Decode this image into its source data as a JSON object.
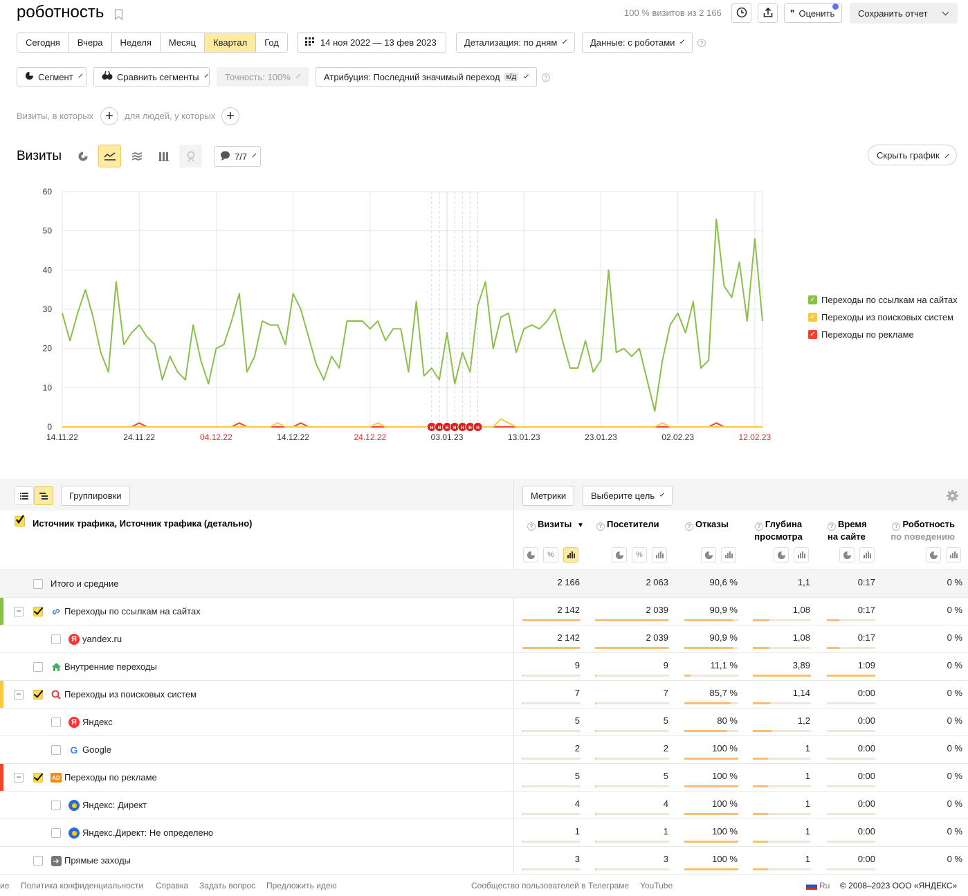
{
  "header": {
    "title": "роботность",
    "visits_info": "100 % визитов из 2 166",
    "rate_label": "Оценить",
    "save_label": "Сохранить отчет"
  },
  "periods": [
    "Сегодня",
    "Вчера",
    "Неделя",
    "Месяц",
    "Квартал",
    "Год"
  ],
  "active_period": "Квартал",
  "date_range": "14 ноя 2022 — 13 фев 2023",
  "detail_label": "Детализация: по дням",
  "data_label": "Данные: с роботами",
  "filters": {
    "segment": "Сегмент",
    "compare": "Сравнить сегменты",
    "accuracy": "Точность: 100%",
    "attribution": "Атрибуция: Последний значимый переход",
    "attribution_badge": "к/д"
  },
  "segment_builder": {
    "visits_label": "Визиты, в которых",
    "people_label": "для людей, у которых"
  },
  "chart_header": {
    "title": "Визиты",
    "annotations": "7/7",
    "hide_label": "Скрыть график"
  },
  "chart_data": {
    "type": "line",
    "x_tick_labels": [
      "14.11.22",
      "24.11.22",
      "04.12.22",
      "14.12.22",
      "24.12.22",
      "03.01.23",
      "13.01.23",
      "23.01.23",
      "02.02.23",
      "12.02.23"
    ],
    "x_tick_weekend": [
      false,
      false,
      true,
      false,
      true,
      false,
      false,
      false,
      false,
      true
    ],
    "y_ticks": [
      0,
      10,
      20,
      30,
      40,
      50,
      60
    ],
    "ylim": [
      0,
      60
    ],
    "annotation_marker": "н",
    "annotation_count": 7,
    "series": [
      {
        "name": "Переходы по ссылкам на сайтах",
        "color": "#8ac04a",
        "values": [
          29,
          22,
          29,
          35,
          28,
          19,
          14,
          37,
          21,
          24,
          26,
          23,
          21,
          12,
          18,
          14,
          12,
          26,
          17,
          11,
          20,
          21,
          27,
          34,
          14,
          18,
          27,
          26,
          26,
          21,
          34,
          30,
          23,
          16,
          12,
          18,
          15,
          27,
          27,
          27,
          25,
          27,
          22,
          25,
          25,
          14,
          32,
          13,
          15,
          12,
          24,
          11,
          19,
          14,
          31,
          37,
          20,
          28,
          29,
          19,
          25,
          26,
          25,
          27,
          30,
          22,
          15,
          15,
          22,
          14,
          17,
          40,
          19,
          20,
          18,
          20,
          12,
          4,
          17,
          26,
          29,
          24,
          32,
          15,
          17,
          53,
          36,
          33,
          42,
          27,
          48,
          27
        ]
      },
      {
        "name": "Переходы из поисковых систем",
        "color": "#f9c83c",
        "values": [
          0,
          0,
          0,
          0,
          0,
          0,
          0,
          0,
          0,
          0,
          0,
          0,
          0,
          0,
          0,
          0,
          0,
          0,
          0,
          0,
          0,
          0,
          0,
          0,
          0,
          0,
          0,
          0,
          1,
          0,
          0,
          0,
          0,
          0,
          0,
          0,
          0,
          0,
          0,
          0,
          0,
          1,
          0,
          0,
          0,
          0,
          0,
          0,
          0,
          0,
          0,
          0,
          0,
          0,
          0,
          0,
          0,
          2,
          1,
          0,
          0,
          0,
          0,
          0,
          0,
          0,
          0,
          0,
          0,
          0,
          0,
          0,
          0,
          0,
          0,
          0,
          0,
          0,
          1,
          0,
          0,
          0,
          0,
          0,
          0,
          0,
          0,
          0,
          0,
          0,
          0,
          0
        ]
      },
      {
        "name": "Переходы по рекламе",
        "color": "#f0452b",
        "values": [
          0,
          0,
          0,
          0,
          0,
          0,
          0,
          0,
          0,
          0,
          1,
          0,
          0,
          0,
          0,
          0,
          0,
          0,
          0,
          0,
          0,
          0,
          0,
          1,
          0,
          0,
          0,
          0,
          0,
          0,
          0,
          1,
          0,
          0,
          0,
          0,
          0,
          0,
          0,
          0,
          0,
          0,
          0,
          0,
          0,
          0,
          0,
          0,
          0,
          0,
          0,
          0,
          0,
          0,
          0,
          0,
          0,
          0,
          0,
          0,
          0,
          0,
          0,
          0,
          0,
          0,
          0,
          0,
          0,
          0,
          0,
          0,
          0,
          0,
          0,
          0,
          0,
          0,
          0,
          0,
          0,
          0,
          0,
          0,
          0,
          1,
          0,
          0,
          0,
          0,
          0,
          0
        ]
      }
    ]
  },
  "table": {
    "groupings_label": "Группировки",
    "metrics_label": "Метрики",
    "goal_label": "Выберите цель",
    "dimension_title": "Источник трафика, Источник трафика (детально)",
    "columns": [
      {
        "label": "Визиты",
        "sort": "▼"
      },
      {
        "label": "Посетители"
      },
      {
        "label": "Отказы"
      },
      {
        "label": "Глубина просмотра"
      },
      {
        "label": "Время на сайте"
      },
      {
        "label": "Роботность",
        "sub": "по поведению"
      }
    ],
    "rows": [
      {
        "label": "Итого и средние",
        "values": [
          "2 166",
          "2 063",
          "90,6 %",
          "1,1",
          "0:17",
          "0 %"
        ],
        "level": 0,
        "total": true
      },
      {
        "label": "Переходы по ссылкам на сайтах",
        "values": [
          "2 142",
          "2 039",
          "90,9 %",
          "1,08",
          "0:17",
          "0 %"
        ],
        "level": 0,
        "icon": "link-icon",
        "tick": "#8ac04a",
        "bars": [
          0.99,
          0.99,
          0.9,
          0.28,
          0.25,
          0
        ]
      },
      {
        "label": "yandex.ru",
        "values": [
          "2 142",
          "2 039",
          "90,9 %",
          "1,08",
          "0:17",
          "0 %"
        ],
        "level": 1,
        "icon": "yandex-icon",
        "bars": [
          0.99,
          0.99,
          0.9,
          0.28,
          0.25,
          0
        ]
      },
      {
        "label": "Внутренние переходы",
        "values": [
          "9",
          "9",
          "11,1 %",
          "3,89",
          "1:09",
          "0 %"
        ],
        "level": 0,
        "icon": "home-icon",
        "bars": [
          0.01,
          0.01,
          0.11,
          1.0,
          1.0,
          0
        ]
      },
      {
        "label": "Переходы из поисковых систем",
        "values": [
          "7",
          "7",
          "85,7 %",
          "1,14",
          "0:00",
          "0 %"
        ],
        "level": 0,
        "icon": "search-icon",
        "tick": "#f9c83c",
        "bars": [
          0.01,
          0.01,
          0.86,
          0.3,
          0,
          0
        ]
      },
      {
        "label": "Яндекс",
        "values": [
          "5",
          "5",
          "80 %",
          "1,2",
          "0:00",
          "0 %"
        ],
        "level": 1,
        "icon": "yandex-icon",
        "bars": [
          0.01,
          0.01,
          0.8,
          0.32,
          0,
          0
        ]
      },
      {
        "label": "Google",
        "values": [
          "2",
          "2",
          "100 %",
          "1",
          "0:00",
          "0 %"
        ],
        "level": 1,
        "icon": "google-icon",
        "bars": [
          0.01,
          0.01,
          1.0,
          0.26,
          0,
          0
        ]
      },
      {
        "label": "Переходы по рекламе",
        "values": [
          "5",
          "5",
          "100 %",
          "1",
          "0:00",
          "0 %"
        ],
        "level": 0,
        "icon": "ad-icon",
        "tick": "#f0452b",
        "bars": [
          0.01,
          0.01,
          1.0,
          0.26,
          0,
          0
        ]
      },
      {
        "label": "Яндекс: Директ",
        "values": [
          "4",
          "4",
          "100 %",
          "1",
          "0:00",
          "0 %"
        ],
        "level": 1,
        "icon": "direct-icon",
        "bars": [
          0.01,
          0.01,
          1.0,
          0.26,
          0,
          0
        ]
      },
      {
        "label": "Яндекс.Директ: Не определено",
        "values": [
          "1",
          "1",
          "100 %",
          "1",
          "0:00",
          "0 %"
        ],
        "level": 1,
        "icon": "direct-icon",
        "bars": [
          0.01,
          0.01,
          1.0,
          0.26,
          0,
          0
        ]
      },
      {
        "label": "Прямые заходы",
        "values": [
          "3",
          "3",
          "100 %",
          "1",
          "0:00",
          "0 %"
        ],
        "level": 0,
        "icon": "arrow-icon",
        "bars": [
          0.01,
          0.01,
          1.0,
          0.26,
          0,
          0
        ]
      }
    ]
  },
  "footer": {
    "truncated": "ие",
    "privacy": "Политика конфиденциальности",
    "help": "Справка",
    "ask": "Задать вопрос",
    "suggest": "Предложить идею",
    "telegram": "Сообщество пользователей в Телеграме",
    "youtube": "YouTube",
    "lang": "Ru",
    "copyright": "© 2008–2023 ООО «ЯНДЕКС»"
  }
}
